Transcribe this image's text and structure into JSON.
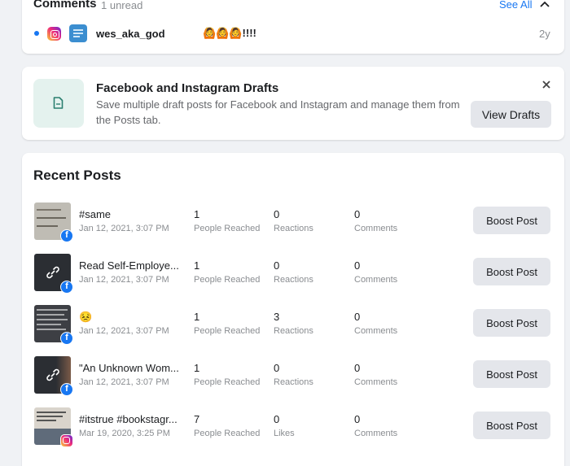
{
  "comments": {
    "title": "Comments",
    "unread": "1 unread",
    "see_all": "See All",
    "item": {
      "platform_icon": "instagram-icon",
      "username": "wes_aka_god",
      "text": "🙆🙆🙆!!!!",
      "time": "2y"
    }
  },
  "drafts": {
    "title": "Facebook and Instagram Drafts",
    "description": "Save multiple draft posts for Facebook and Instagram and manage them from the Posts tab.",
    "button": "View Drafts",
    "close_icon": "close-icon"
  },
  "recent_posts": {
    "title": "Recent Posts",
    "boost_label": "Boost Post",
    "posts": [
      {
        "title": "#same",
        "date": "Jan 12, 2021, 3:07 PM",
        "platform": "facebook",
        "reach": "1",
        "reach_label": "People Reached",
        "reactions": "0",
        "reactions_label": "Reactions",
        "comments": "0",
        "comments_label": "Comments"
      },
      {
        "title": "Read Self-Employe...",
        "date": "Jan 12, 2021, 3:07 PM",
        "platform": "facebook",
        "reach": "1",
        "reach_label": "People Reached",
        "reactions": "0",
        "reactions_label": "Reactions",
        "comments": "0",
        "comments_label": "Comments"
      },
      {
        "title": "😣",
        "date": "Jan 12, 2021, 3:07 PM",
        "platform": "facebook",
        "reach": "1",
        "reach_label": "People Reached",
        "reactions": "3",
        "reactions_label": "Reactions",
        "comments": "0",
        "comments_label": "Comments"
      },
      {
        "title": "\"An Unknown Wom...",
        "date": "Jan 12, 2021, 3:07 PM",
        "platform": "facebook",
        "reach": "1",
        "reach_label": "People Reached",
        "reactions": "0",
        "reactions_label": "Reactions",
        "comments": "0",
        "comments_label": "Comments"
      },
      {
        "title": "#itstrue #bookstagr...",
        "date": "Mar 19, 2020, 3:25 PM",
        "platform": "instagram",
        "reach": "7",
        "reach_label": "People Reached",
        "reactions": "0",
        "reactions_label": "Likes",
        "comments": "0",
        "comments_label": "Comments"
      }
    ]
  },
  "colors": {
    "accent": "#1877f2",
    "background": "#f0f2f5",
    "button_bg": "#e4e6eb",
    "muted_text": "#8a8d91"
  }
}
